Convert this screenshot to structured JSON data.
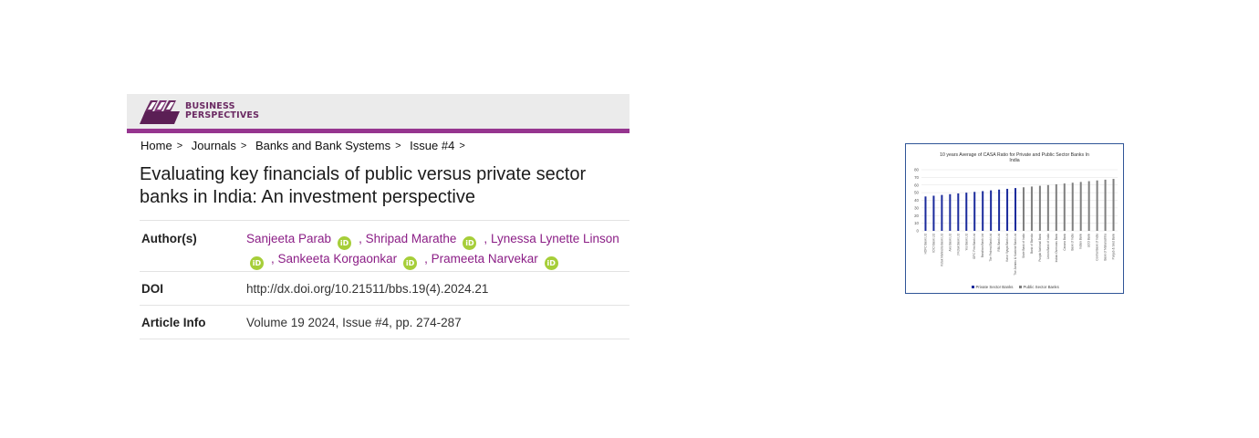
{
  "header": {
    "brand_line1": "BUSINESS",
    "brand_line2": "PERSPECTIVES",
    "brand_color": "#6b2a63",
    "accent_bar_color": "#96358f"
  },
  "breadcrumb": [
    "Home",
    "Journals",
    "Banks and Bank Systems",
    "Issue #4"
  ],
  "breadcrumb_separator": ">",
  "article": {
    "title": "Evaluating key financials of public versus private sector banks in India: An investment perspective",
    "authors_label": "Author(s)",
    "authors": [
      "Sanjeeta Parab",
      "Shripad Marathe",
      "Lynessa Lynette Linson",
      "Sankeeta Korgaonkar",
      "Prameeta Narvekar"
    ],
    "orcid_icon_text": "iD",
    "orcid_color": "#a6ce39",
    "author_link_color": "#8b1e86",
    "doi_label": "DOI",
    "doi_value": "http://dx.doi.org/10.21511/bbs.19(4).2024.21",
    "info_label": "Article Info",
    "info_value": "Volume 19 2024, Issue #4, pp. 274-287"
  },
  "chart_data": {
    "type": "bar",
    "title": "10 years Average of CASA Ratio for Private and Public Sector Banks In India",
    "xlabel": "",
    "ylabel": "",
    "ylim": [
      0,
      80
    ],
    "yticks": [
      0,
      10,
      20,
      30,
      40,
      50,
      60,
      70,
      80
    ],
    "grid": true,
    "legend_position": "bottom",
    "categories": [
      "HDFC Bank Ltd",
      "ICICI Bank Ltd",
      "Kotak Mahindra Bank Ltd",
      "Axis Bank Ltd",
      "J Kotak Bank Ltd",
      "Yes Bank Ltd",
      "IDFC First Bank Ltd",
      "Bandhan Bank Ltd",
      "The Federal Bank Ltd",
      "RBL Bank Ltd",
      "Karur Vysya Bank Ltd",
      "The Jammu & Kashmir Bank Ltd",
      "State Bank of India",
      "Bank of Baroda",
      "Punjab National Bank",
      "Union Bank of India",
      "Indian Overseas Bank",
      "Canara Bank",
      "Bank of India",
      "Indian Bank",
      "UCO Bank",
      "Central Bank of India",
      "Bank of Maharashtra",
      "Punjab & Sind Bank"
    ],
    "series": [
      {
        "name": "Private Sector Banks",
        "color": "#1a2a9c",
        "values": [
          45,
          46,
          47,
          48,
          49,
          50,
          51,
          52,
          53,
          54,
          55,
          56,
          null,
          null,
          null,
          null,
          null,
          null,
          null,
          null,
          null,
          null,
          null,
          null
        ]
      },
      {
        "name": "Public Sector Banks",
        "color": "#7f7f7f",
        "values": [
          null,
          null,
          null,
          null,
          null,
          null,
          null,
          null,
          null,
          null,
          null,
          null,
          57,
          58,
          59,
          60,
          61,
          62,
          63,
          64,
          65,
          66,
          67,
          68
        ]
      }
    ]
  }
}
